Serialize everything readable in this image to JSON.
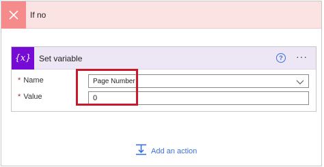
{
  "branch": {
    "title": "If no",
    "icon": "close-icon",
    "header_color": "#fbe3e3",
    "icon_bg": "#f58b8b"
  },
  "action": {
    "title": "Set variable",
    "icon_label": "{x}",
    "icon": "variable-icon",
    "accent": "#770bd6",
    "help_label": "?",
    "more_label": "···"
  },
  "fields": {
    "name": {
      "required_mark": "*",
      "label": "Name",
      "value": "Page Number"
    },
    "value": {
      "required_mark": "*",
      "label": "Value",
      "value": "0"
    }
  },
  "footer": {
    "add_action_label": "Add an action",
    "icon": "add-action-icon"
  }
}
